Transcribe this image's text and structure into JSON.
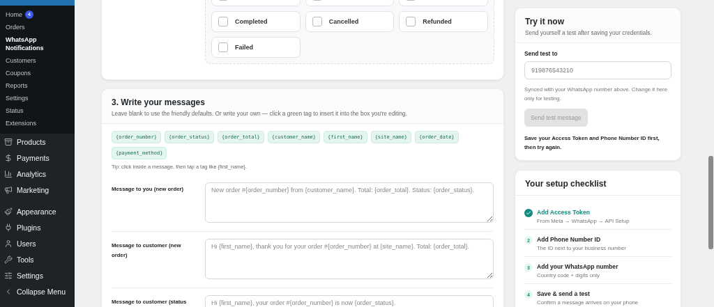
{
  "sidebar": {
    "submenu": [
      {
        "label": "Home",
        "badge": "4",
        "selected": false
      },
      {
        "label": "Orders",
        "selected": false
      },
      {
        "label": "WhatsApp Notifications",
        "selected": true
      },
      {
        "label": "Customers",
        "selected": false
      },
      {
        "label": "Coupons",
        "selected": false
      },
      {
        "label": "Reports",
        "selected": false
      },
      {
        "label": "Settings",
        "selected": false
      },
      {
        "label": "Status",
        "selected": false
      },
      {
        "label": "Extensions",
        "selected": false
      }
    ],
    "menu": [
      {
        "label": "Products"
      },
      {
        "label": "Payments"
      },
      {
        "label": "Analytics"
      },
      {
        "label": "Marketing"
      },
      {
        "label": "Appearance"
      },
      {
        "label": "Plugins"
      },
      {
        "label": "Users"
      },
      {
        "label": "Tools"
      },
      {
        "label": "Settings"
      },
      {
        "label": "Collapse Menu"
      }
    ]
  },
  "statuses": {
    "partial": [
      {
        "checked": false
      },
      {
        "checked": false
      },
      {
        "checked": false
      }
    ],
    "items": [
      {
        "label": "Completed",
        "checked": false
      },
      {
        "label": "Cancelled",
        "checked": false
      },
      {
        "label": "Refunded",
        "checked": false
      },
      {
        "label": "Failed",
        "checked": false
      }
    ]
  },
  "messages": {
    "title": "3. Write your messages",
    "subtitle": "Leave blank to use the friendly defaults. Or write your own — click a green tag to insert it into the box you're editing.",
    "tags": [
      "{order_number}",
      "{order_status}",
      "{order_total}",
      "{customer_name}",
      "{first_name}",
      "{site_name}",
      "{order_date}",
      "{payment_method}"
    ],
    "tip": "Tip: click inside a message, then tap a tag like {first_name}.",
    "fields": [
      {
        "label": "Message to you (new order)",
        "placeholder": "New order #{order_number} from {customer_name}. Total: {order_total}. Status: {order_status}."
      },
      {
        "label": "Message to customer (new order)",
        "placeholder": "Hi {first_name}, thank you for your order #{order_number} at {site_name}. Total: {order_total}."
      },
      {
        "label": "Message to customer (status",
        "placeholder": "Hi {first_name}, your order #{order_number} is now {order_status}."
      }
    ]
  },
  "try_it": {
    "title": "Try it now",
    "subtitle": "Send yourself a test after saving your credentials.",
    "field_label": "Send test to",
    "field_placeholder": "919876543210",
    "help": "Synced with your WhatsApp number above. Change it here only for testing.",
    "button": "Send test message",
    "button_disabled": true,
    "warning": "Save your Access Token and Phone Number ID first, then try again."
  },
  "checklist": {
    "title": "Your setup checklist",
    "steps": [
      {
        "title": "Add Access Token",
        "detail": "From Meta → WhatsApp → API Setup",
        "done": true
      },
      {
        "number": "2",
        "title": "Add Phone Number ID",
        "detail": "The ID next to your business number",
        "done": false
      },
      {
        "number": "3",
        "title": "Add your WhatsApp number",
        "detail": "Country code + digits only",
        "done": false
      },
      {
        "number": "4",
        "title": "Save & send a test",
        "detail": "Confirm a message arrives on your phone",
        "done": false
      }
    ]
  }
}
